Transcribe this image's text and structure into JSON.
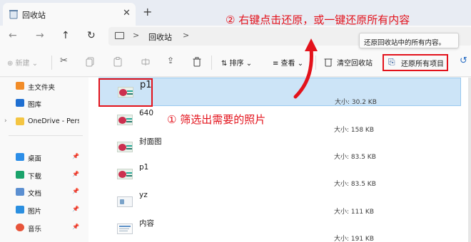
{
  "tab": {
    "title": "回收站",
    "close": "✕",
    "new_tab": "+"
  },
  "nav": {
    "back": "←",
    "forward": "→",
    "up": "↑",
    "refresh": "↻"
  },
  "address": {
    "chevron": ">",
    "location": "回收站",
    "tail_chevron": ">"
  },
  "tooltip": "还原回收站中的所有内容。",
  "toolbar": {
    "new": "⊕ 新建 ⌄",
    "sort": "⇅ 排序 ⌄",
    "view": "≡ 查看 ⌄",
    "empty_bin": "清空回收站",
    "restore_all": "还原所有项目",
    "cut_icon": "✂",
    "share_icon": "⇪",
    "delete_icon": "🗑",
    "more_icon": "↺"
  },
  "sidebar": {
    "items": [
      {
        "label": "主文件夹",
        "icon": "home-icon",
        "color": "#f28c28"
      },
      {
        "label": "图库",
        "icon": "gallery-icon",
        "color": "#1f6fd1"
      },
      {
        "label": "OneDrive - Pers",
        "icon": "folder-icon",
        "color": "#f4c542"
      },
      {
        "label": "桌面",
        "icon": "desktop-icon",
        "color": "#2c8ee8"
      },
      {
        "label": "下载",
        "icon": "download-icon",
        "color": "#1aa36b"
      },
      {
        "label": "文档",
        "icon": "documents-icon",
        "color": "#5b8fd1"
      },
      {
        "label": "图片",
        "icon": "pictures-icon",
        "color": "#2b8fe0"
      },
      {
        "label": "音乐",
        "icon": "music-icon",
        "color": "#e7543a"
      }
    ],
    "pin": "📌",
    "expand": "›"
  },
  "files": [
    {
      "name": "p1",
      "size": "大小: 30.2 KB",
      "selected": true
    },
    {
      "name": "640",
      "size": "大小: 158 KB"
    },
    {
      "name": "封面图",
      "size": "大小: 83.5 KB"
    },
    {
      "name": "p1",
      "size": "大小: 83.5 KB"
    },
    {
      "name": "yz",
      "size": "大小: 111 KB"
    },
    {
      "name": "内容",
      "size": "大小: 191 KB"
    }
  ],
  "annotations": {
    "step1": "① 筛选出需要的照片",
    "step2": "② 右键点击还原，或一键还原所有内容"
  },
  "colors": {
    "annotation_red": "#e3121b",
    "selection": "#cce4f7"
  }
}
